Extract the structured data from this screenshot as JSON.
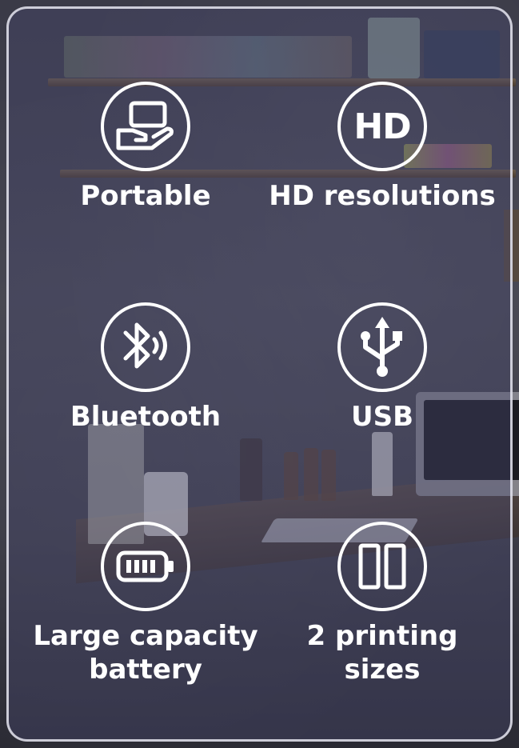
{
  "features": [
    {
      "label": "Portable",
      "icon": "hand-holding-device-icon"
    },
    {
      "label": "HD resolutions",
      "icon": "hd-icon",
      "icon_text": "HD"
    },
    {
      "label": "Bluetooth",
      "icon": "bluetooth-icon"
    },
    {
      "label": "USB",
      "icon": "usb-icon"
    },
    {
      "label": "Large capacity",
      "label_line2": "battery",
      "icon": "battery-icon"
    },
    {
      "label": "2 printing",
      "label_line2": "sizes",
      "icon": "two-sizes-icon"
    }
  ],
  "colors": {
    "overlay": "#46466e",
    "icon_stroke": "#ffffff",
    "text": "#ffffff"
  }
}
